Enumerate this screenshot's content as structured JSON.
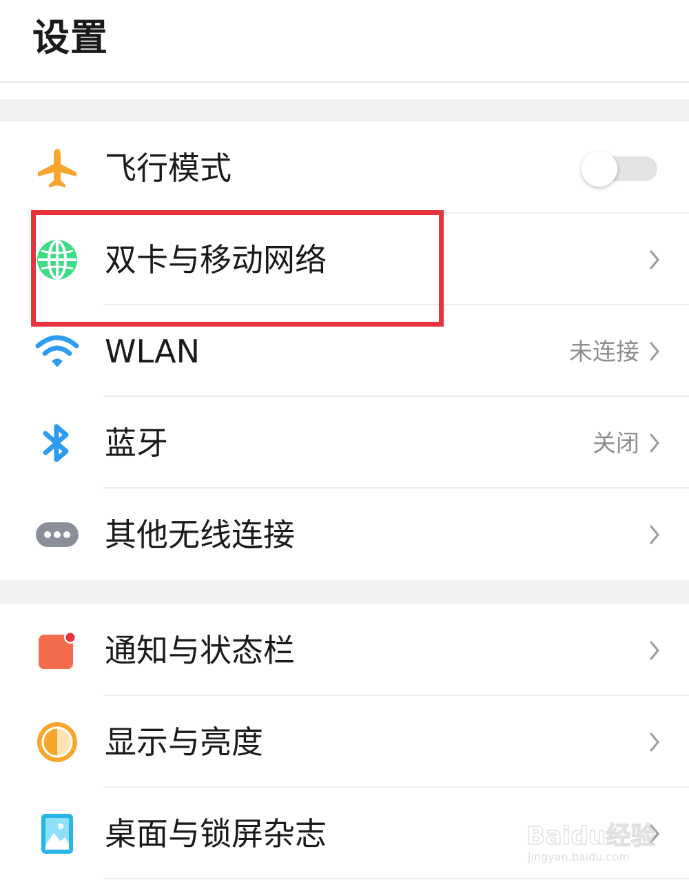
{
  "header": {
    "title": "设置"
  },
  "sections": [
    {
      "items": [
        {
          "label": "飞行模式",
          "icon": "airplane-icon",
          "control": "toggle",
          "toggle_on": false
        },
        {
          "label": "双卡与移动网络",
          "icon": "globe-icon",
          "control": "chevron",
          "highlighted": true
        },
        {
          "label": "WLAN",
          "icon": "wifi-icon",
          "value": "未连接",
          "control": "chevron"
        },
        {
          "label": "蓝牙",
          "icon": "bluetooth-icon",
          "value": "关闭",
          "control": "chevron"
        },
        {
          "label": "其他无线连接",
          "icon": "more-dots-icon",
          "control": "chevron"
        }
      ]
    },
    {
      "items": [
        {
          "label": "通知与状态栏",
          "icon": "notification-icon",
          "control": "chevron"
        },
        {
          "label": "显示与亮度",
          "icon": "brightness-icon",
          "control": "chevron"
        },
        {
          "label": "桌面与锁屏杂志",
          "icon": "wallpaper-icon",
          "control": "chevron"
        }
      ]
    }
  ],
  "watermark": {
    "brand": "Baidu经验",
    "url": "jingyan.baidu.com"
  },
  "colors": {
    "highlight": "#e8323c",
    "airplane": "#f7a52c",
    "globe": "#3ddc84",
    "wifi": "#2d9cf0",
    "bluetooth": "#2d9cf0",
    "more": "#8a8f99",
    "notification": "#f26b4a",
    "brightness": "#f7a52c",
    "wallpaper": "#28b6e8"
  }
}
